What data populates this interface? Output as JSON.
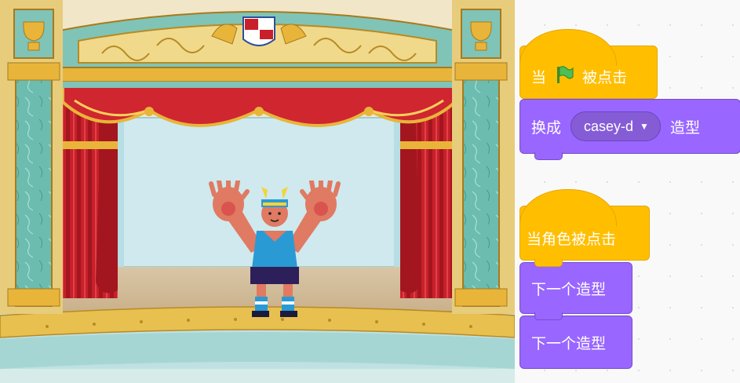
{
  "code": {
    "script1": {
      "hat_prefix": "当",
      "flag_icon": "green-flag-icon",
      "hat_suffix": "被点击",
      "switch_prefix": "换成",
      "costume_value": "casey-d",
      "switch_suffix": "造型"
    },
    "script2": {
      "hat_label": "当角色被点击",
      "next1_label": "下一个造型",
      "next2_label": "下一个造型"
    }
  },
  "colors": {
    "event": "#ffbf00",
    "looks": "#9966ff",
    "curtain": "#c8202a",
    "gold": "#e8b53a",
    "marble": "#5fb3a8"
  }
}
